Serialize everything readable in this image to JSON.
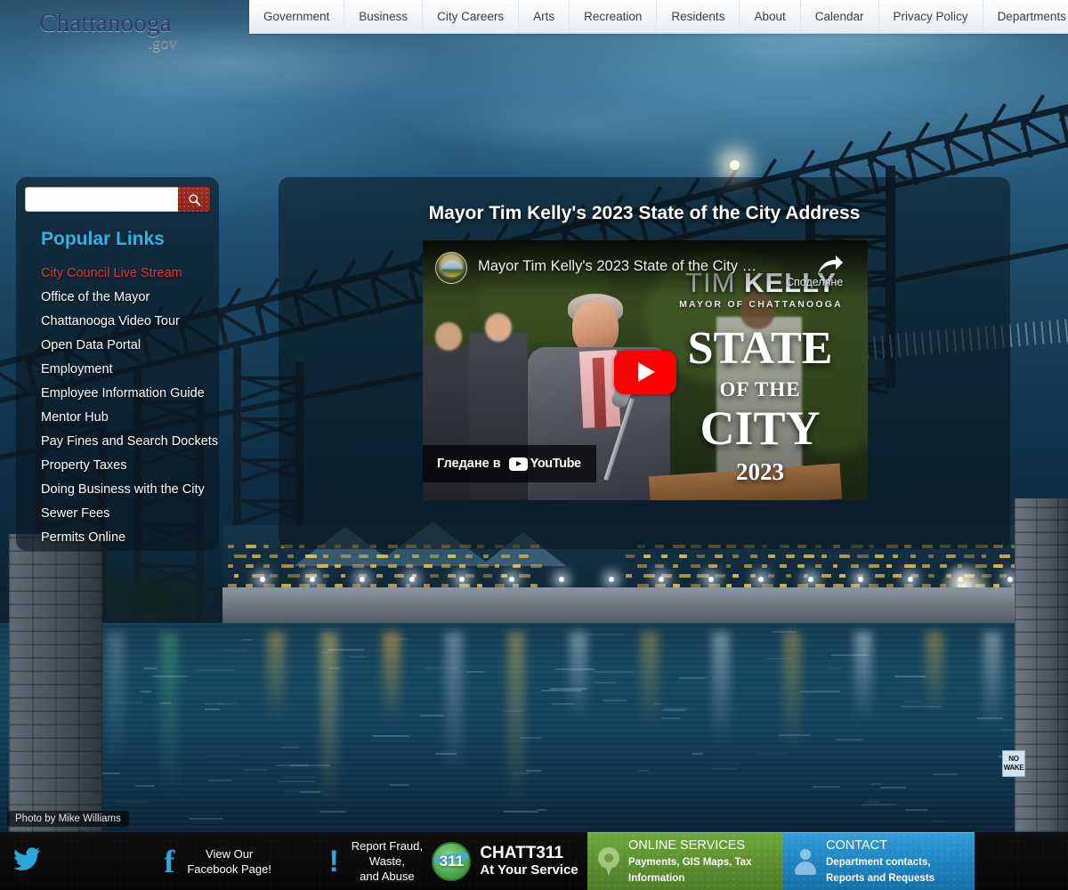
{
  "site": {
    "logo_main": "Chattanooga",
    "logo_suffix": ".gov"
  },
  "nav": {
    "items": [
      {
        "label": "Government"
      },
      {
        "label": "Business"
      },
      {
        "label": "City Careers"
      },
      {
        "label": "Arts"
      },
      {
        "label": "Recreation"
      },
      {
        "label": "Residents"
      },
      {
        "label": "About"
      },
      {
        "label": "Calendar"
      },
      {
        "label": "Privacy Policy"
      },
      {
        "label": "Departments"
      }
    ]
  },
  "sidebar": {
    "search": {
      "value": "",
      "placeholder": "",
      "icon": "search-icon"
    },
    "title": "Popular Links",
    "links": [
      {
        "label": "City Council Live Stream",
        "highlight": true
      },
      {
        "label": "Office of the Mayor",
        "highlight": false
      },
      {
        "label": "Chattanooga Video Tour",
        "highlight": false
      },
      {
        "label": "Open Data Portal",
        "highlight": false
      },
      {
        "label": "Employment",
        "highlight": false
      },
      {
        "label": "Employee Information Guide",
        "highlight": false
      },
      {
        "label": "Mentor Hub",
        "highlight": false
      },
      {
        "label": "Pay Fines and Search Dockets",
        "highlight": false
      },
      {
        "label": "Property Taxes",
        "highlight": false
      },
      {
        "label": "Doing Business with the City",
        "highlight": false
      },
      {
        "label": "Sewer Fees",
        "highlight": false
      },
      {
        "label": "Permits Online",
        "highlight": false
      }
    ]
  },
  "feature": {
    "title": "Mayor Tim Kelly's 2023 State of the City Address",
    "video": {
      "player_title": "Mayor Tim Kelly's 2023 State of the City …",
      "share_tooltip": "Споделяне",
      "watch_on_label": "Гледане в",
      "youtube_label": "YouTube",
      "channel_icon": "chattanooga-city-seal-icon",
      "play_icon": "youtube-play-icon",
      "share_icon": "share-arrow-icon",
      "overlay": {
        "name_thin": "TIM ",
        "name_bold": "KELLY",
        "subtitle": "MAYOR OF CHATTANOOGA",
        "line1": "STATE",
        "line2": "OF THE",
        "line3": "CITY",
        "year": "2023"
      }
    }
  },
  "hero": {
    "photo_credit": "Photo by Mike Williams",
    "sign_line1": "NO",
    "sign_line2": "WAKE"
  },
  "footer": {
    "twitter_icon": "twitter-bird-icon",
    "facebook": {
      "icon": "facebook-f-icon",
      "line1": "View Our",
      "line2": "Facebook Page!"
    },
    "fraud": {
      "icon": "exclamation-icon",
      "line1": "Report Fraud,",
      "line2": "Waste,",
      "line3": "and Abuse"
    },
    "chatt311": {
      "badge": "311",
      "title": "CHATT311",
      "subtitle": "At Your Service"
    },
    "online_services": {
      "icon": "map-pin-icon",
      "title": "ONLINE SERVICES",
      "subtitle": "Payments, GIS Maps, Tax Information"
    },
    "contact": {
      "icon": "person-icon",
      "title": "CONTACT",
      "subtitle": "Department contacts, Reports and Requests"
    }
  },
  "colors": {
    "logo": "#2a3b6e",
    "accent_cyan": "#29b7e8",
    "highlight_red": "#e8372a",
    "search_button": "#8d2318",
    "green_panel": "#5d9130",
    "blue_panel": "#1f86c2",
    "youtube_red": "#ff0000"
  }
}
